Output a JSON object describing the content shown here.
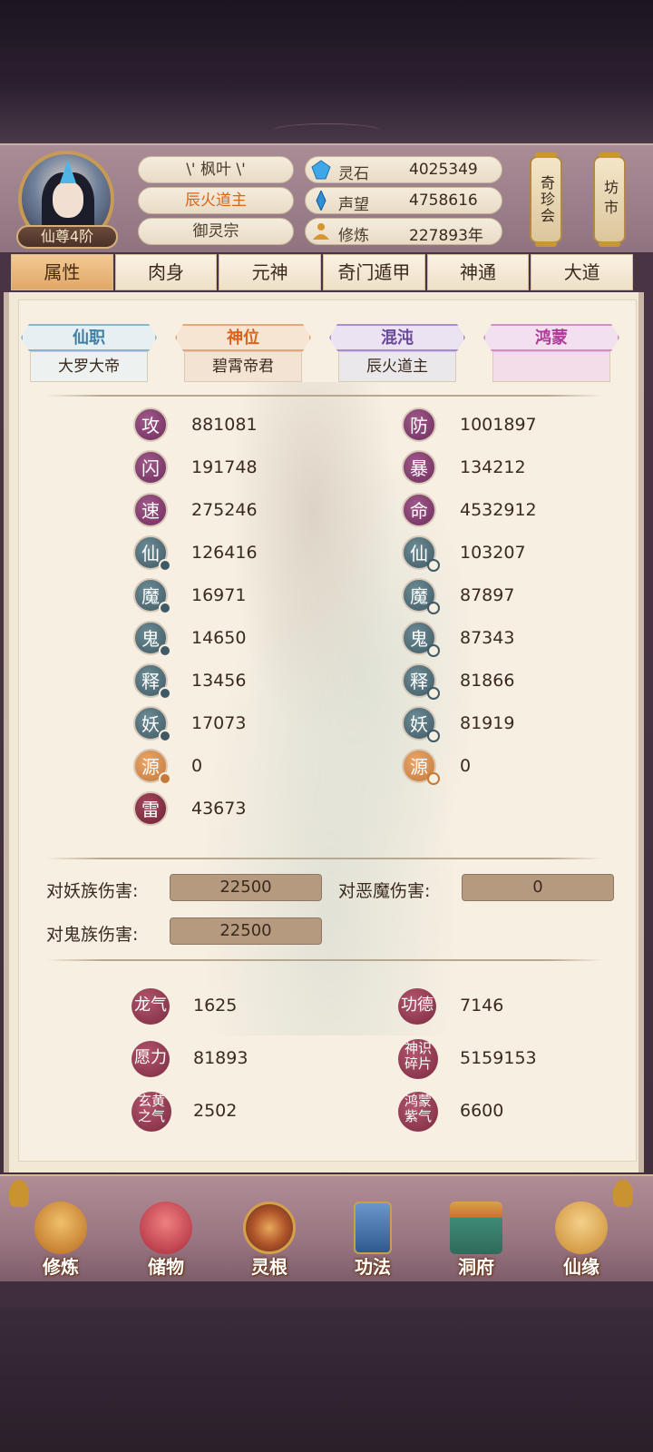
{
  "header": {
    "rank_badge": "仙尊4阶",
    "name": "\\' 枫叶 \\'",
    "title": "辰火道主",
    "sect": "御灵宗",
    "resources": [
      {
        "label": "灵石",
        "value": "4025349",
        "icon": "spirit-stone-icon",
        "color": "#3fa7e6"
      },
      {
        "label": "声望",
        "value": "4758616",
        "icon": "prestige-crystal-icon",
        "color": "#2f8ed6"
      },
      {
        "label": "修炼",
        "value": "227893年",
        "icon": "meditation-icon",
        "color": "#d9952f"
      }
    ],
    "side_buttons": [
      "奇珍会",
      "坊市"
    ]
  },
  "tabs": [
    {
      "label": "属性",
      "active": true
    },
    {
      "label": "肉身",
      "active": false
    },
    {
      "label": "元神",
      "active": false
    },
    {
      "label": "奇门遁甲",
      "active": false
    },
    {
      "label": "神通",
      "active": false
    },
    {
      "label": "大道",
      "active": false
    }
  ],
  "ranks": [
    {
      "head": "仙职",
      "value": "大罗大帝"
    },
    {
      "head": "神位",
      "value": "碧霄帝君"
    },
    {
      "head": "混沌",
      "value": "辰火道主"
    },
    {
      "head": "鸿蒙",
      "value": ""
    }
  ],
  "stats_left": [
    {
      "char": "攻",
      "value": "881081",
      "style": "purple"
    },
    {
      "char": "闪",
      "value": "191748",
      "style": "purple"
    },
    {
      "char": "速",
      "value": "275246",
      "style": "purple"
    },
    {
      "char": "仙",
      "value": "126416",
      "style": "teal"
    },
    {
      "char": "魔",
      "value": "16971",
      "style": "teal"
    },
    {
      "char": "鬼",
      "value": "14650",
      "style": "teal"
    },
    {
      "char": "释",
      "value": "13456",
      "style": "teal"
    },
    {
      "char": "妖",
      "value": "17073",
      "style": "teal"
    },
    {
      "char": "源",
      "value": "0",
      "style": "orange"
    },
    {
      "char": "雷",
      "value": "43673",
      "style": "maroon"
    }
  ],
  "stats_right": [
    {
      "char": "防",
      "value": "1001897",
      "style": "purple"
    },
    {
      "char": "暴",
      "value": "134212",
      "style": "purple"
    },
    {
      "char": "命",
      "value": "4532912",
      "style": "purple"
    },
    {
      "char": "仙",
      "value": "103207",
      "style": "teal"
    },
    {
      "char": "魔",
      "value": "87897",
      "style": "teal"
    },
    {
      "char": "鬼",
      "value": "87343",
      "style": "teal"
    },
    {
      "char": "释",
      "value": "81866",
      "style": "teal"
    },
    {
      "char": "妖",
      "value": "81919",
      "style": "teal"
    },
    {
      "char": "源",
      "value": "0",
      "style": "orange"
    }
  ],
  "damage": [
    {
      "label": "对妖族伤害:",
      "value": "22500"
    },
    {
      "label": "对恶魔伤害:",
      "value": "0"
    },
    {
      "label": "对鬼族伤害:",
      "value": "22500"
    }
  ],
  "extras": [
    {
      "char": "龙气",
      "value": "1625"
    },
    {
      "char": "功德",
      "value": "7146"
    },
    {
      "char": "愿力",
      "value": "81893"
    },
    {
      "char": "神识碎片",
      "value": "5159153"
    },
    {
      "char": "玄黄之气",
      "value": "2502"
    },
    {
      "char": "鸿蒙紫气",
      "value": "6600"
    }
  ],
  "bottom_nav": [
    {
      "label": "修炼",
      "icon": "cultivate-icon",
      "color": "#d9952f"
    },
    {
      "label": "储物",
      "icon": "storage-bag-icon",
      "color": "#c9474a"
    },
    {
      "label": "灵根",
      "icon": "spirit-root-icon",
      "color": "#c96a2f"
    },
    {
      "label": "功法",
      "icon": "technique-book-icon",
      "color": "#4a76b0"
    },
    {
      "label": "洞府",
      "icon": "cave-dwelling-icon",
      "color": "#3f8a78"
    },
    {
      "label": "仙缘",
      "icon": "immortal-fate-icon",
      "color": "#d99a3f"
    }
  ]
}
